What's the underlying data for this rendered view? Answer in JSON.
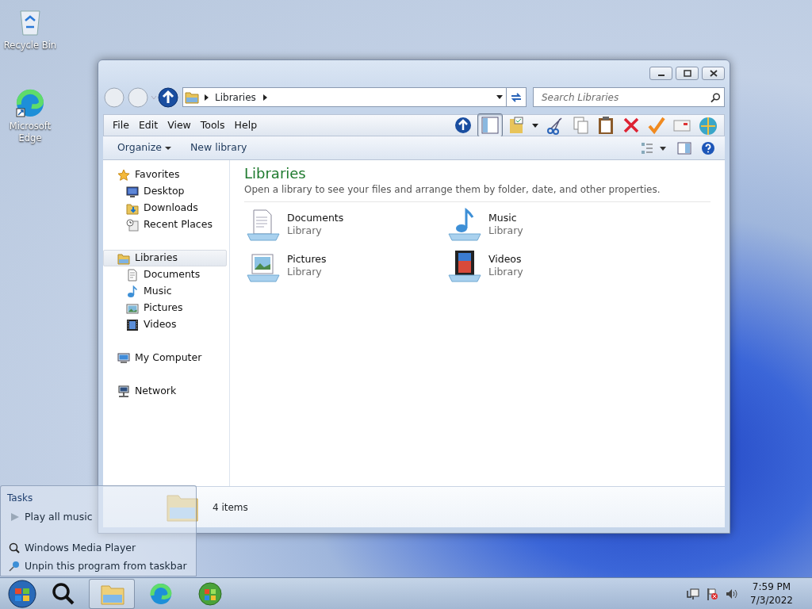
{
  "desktop_icons": [
    {
      "label": "Recycle Bin",
      "kind": "bin"
    },
    {
      "label": "Microsoft Edge",
      "kind": "edge"
    }
  ],
  "window": {
    "address": {
      "crumbs": [
        "Libraries"
      ]
    },
    "search": {
      "placeholder": "Search Libraries"
    },
    "menu": [
      "File",
      "Edit",
      "View",
      "Tools",
      "Help"
    ],
    "commands": [
      {
        "label": "Organize",
        "kind": "dropdown"
      },
      {
        "label": "New library",
        "kind": "plain"
      }
    ],
    "nav": [
      {
        "label": "Favorites",
        "kind": "star",
        "selected": false,
        "children": [
          {
            "label": "Desktop",
            "kind": "desktop",
            "selected": false
          },
          {
            "label": "Downloads",
            "kind": "downloads",
            "selected": false
          },
          {
            "label": "Recent Places",
            "kind": "recent",
            "selected": false
          }
        ]
      },
      {
        "label": "Libraries",
        "kind": "library",
        "selected": true,
        "children": [
          {
            "label": "Documents",
            "kind": "documents",
            "selected": false
          },
          {
            "label": "Music",
            "kind": "music",
            "selected": false
          },
          {
            "label": "Pictures",
            "kind": "pictures",
            "selected": false
          },
          {
            "label": "Videos",
            "kind": "videos",
            "selected": false
          }
        ]
      },
      {
        "label": "My Computer",
        "kind": "computer",
        "selected": false
      },
      {
        "label": "Network",
        "kind": "network",
        "selected": false
      }
    ],
    "content": {
      "title": "Libraries",
      "subtitle": "Open a library to see your files and arrange them by folder, date, and other properties.",
      "items": [
        {
          "name": "Documents",
          "type": "Library",
          "kind": "documents"
        },
        {
          "name": "Music",
          "type": "Library",
          "kind": "music"
        },
        {
          "name": "Pictures",
          "type": "Library",
          "kind": "pictures"
        },
        {
          "name": "Videos",
          "type": "Library",
          "kind": "videos"
        }
      ]
    },
    "status": "4 items"
  },
  "jump_list": {
    "heading": "Tasks",
    "tasks": [
      "Play all music"
    ],
    "items": [
      {
        "label": "Windows Media Player",
        "kind": "app"
      },
      {
        "label": "Unpin this program from taskbar",
        "kind": "unpin"
      }
    ]
  },
  "taskbar": {
    "buttons": [
      {
        "kind": "player",
        "selected": false
      },
      {
        "kind": "explorer",
        "selected": true
      },
      {
        "kind": "edge",
        "selected": false
      },
      {
        "kind": "orb",
        "selected": false
      }
    ],
    "clock": {
      "time": "7:59 PM",
      "date": "7/3/2022"
    }
  }
}
